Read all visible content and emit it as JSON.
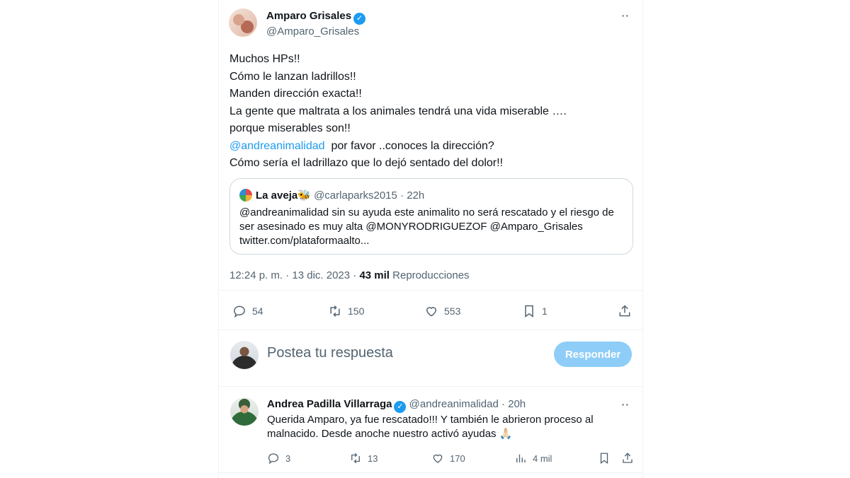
{
  "tweet": {
    "author_name": "Amparo Grisales",
    "author_handle": "@Amparo_Grisales",
    "more_label": "··",
    "lines": [
      "Muchos HPs!!",
      "Cómo le lanzan ladrillos!!",
      "Manden dirección exacta!!",
      "La gente que maltrata a los animales tendrá una vida miserable ….",
      "porque miserables son!!"
    ],
    "mention": "@andreanimalidad",
    "mention_rest": "  por favor ..conoces la dirección?",
    "last_line": "Cómo sería el ladrillazo que lo dejó sentado del dolor!!",
    "time": "12:24 p. m. · 13 dic. 2023 ·",
    "views_count": "43 mil",
    "views_label": "Reproducciones",
    "replies": "54",
    "retweets": "150",
    "likes": "553",
    "bookmarks": "1"
  },
  "quote": {
    "name": "La aveja",
    "emoji": "🐝",
    "meta": "@carlaparks2015 · 22h",
    "text": "@andreanimalidad sin su ayuda este animalito no será rescatado y el riesgo de ser asesinado es muy alta @MONYRODRIGUEZOF @Amparo_Grisales twitter.com/plataformaalto..."
  },
  "composer": {
    "placeholder": "Postea tu respuesta",
    "button_label": "Responder"
  },
  "reply": {
    "name": "Andrea Padilla Villarraga",
    "meta": "@andreanimalidad · 20h",
    "more_label": "··",
    "text": "Querida Amparo, ya fue rescatado!!! Y también le abrieron proceso al malnacido. Desde anoche nuestro activó ayudas 🙏🏻",
    "replies": "3",
    "retweets": "13",
    "likes": "170",
    "views": "4 mil"
  },
  "colors": {
    "accent": "#1d9bf0",
    "muted": "#536471",
    "reply_button": "#8ecdf7"
  }
}
